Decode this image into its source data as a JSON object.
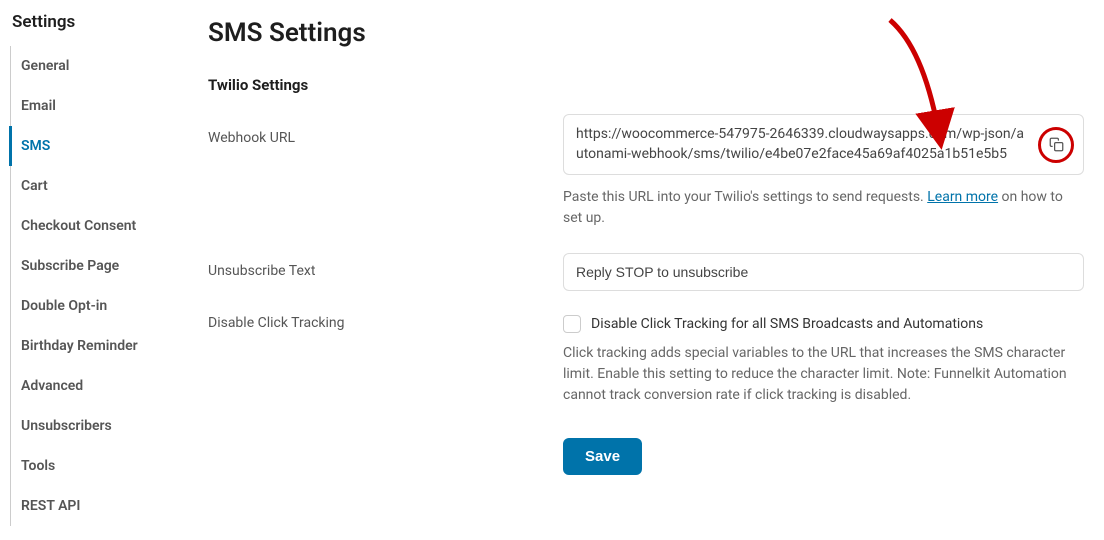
{
  "sidebar": {
    "title": "Settings",
    "items": [
      {
        "label": "General"
      },
      {
        "label": "Email"
      },
      {
        "label": "SMS"
      },
      {
        "label": "Cart"
      },
      {
        "label": "Checkout Consent"
      },
      {
        "label": "Subscribe Page"
      },
      {
        "label": "Double Opt-in"
      },
      {
        "label": "Birthday Reminder"
      },
      {
        "label": "Advanced"
      },
      {
        "label": "Unsubscribers"
      },
      {
        "label": "Tools"
      },
      {
        "label": "REST API"
      }
    ],
    "active_index": 2
  },
  "main": {
    "page_title": "SMS Settings",
    "section_title": "Twilio Settings",
    "webhook": {
      "label": "Webhook URL",
      "value": "https://woocommerce-547975-2646339.cloudwaysapps.com/wp-json/autonami-webhook/sms/twilio/e4be07e2face45a69af4025a1b51e5b5",
      "helper_prefix": "Paste this URL into your Twilio's settings to send requests. ",
      "learn_more": "Learn more",
      "helper_suffix": " on how to set up."
    },
    "unsubscribe": {
      "label": "Unsubscribe Text",
      "value": "Reply STOP to unsubscribe"
    },
    "click_tracking": {
      "label": "Disable Click Tracking",
      "checkbox_label": "Disable Click Tracking for all SMS Broadcasts and Automations",
      "description": "Click tracking adds special variables to the URL that increases the SMS character limit. Enable this setting to reduce the character limit. Note: Funnelkit Automation cannot track conversion rate if click tracking is disabled."
    },
    "save_label": "Save"
  }
}
